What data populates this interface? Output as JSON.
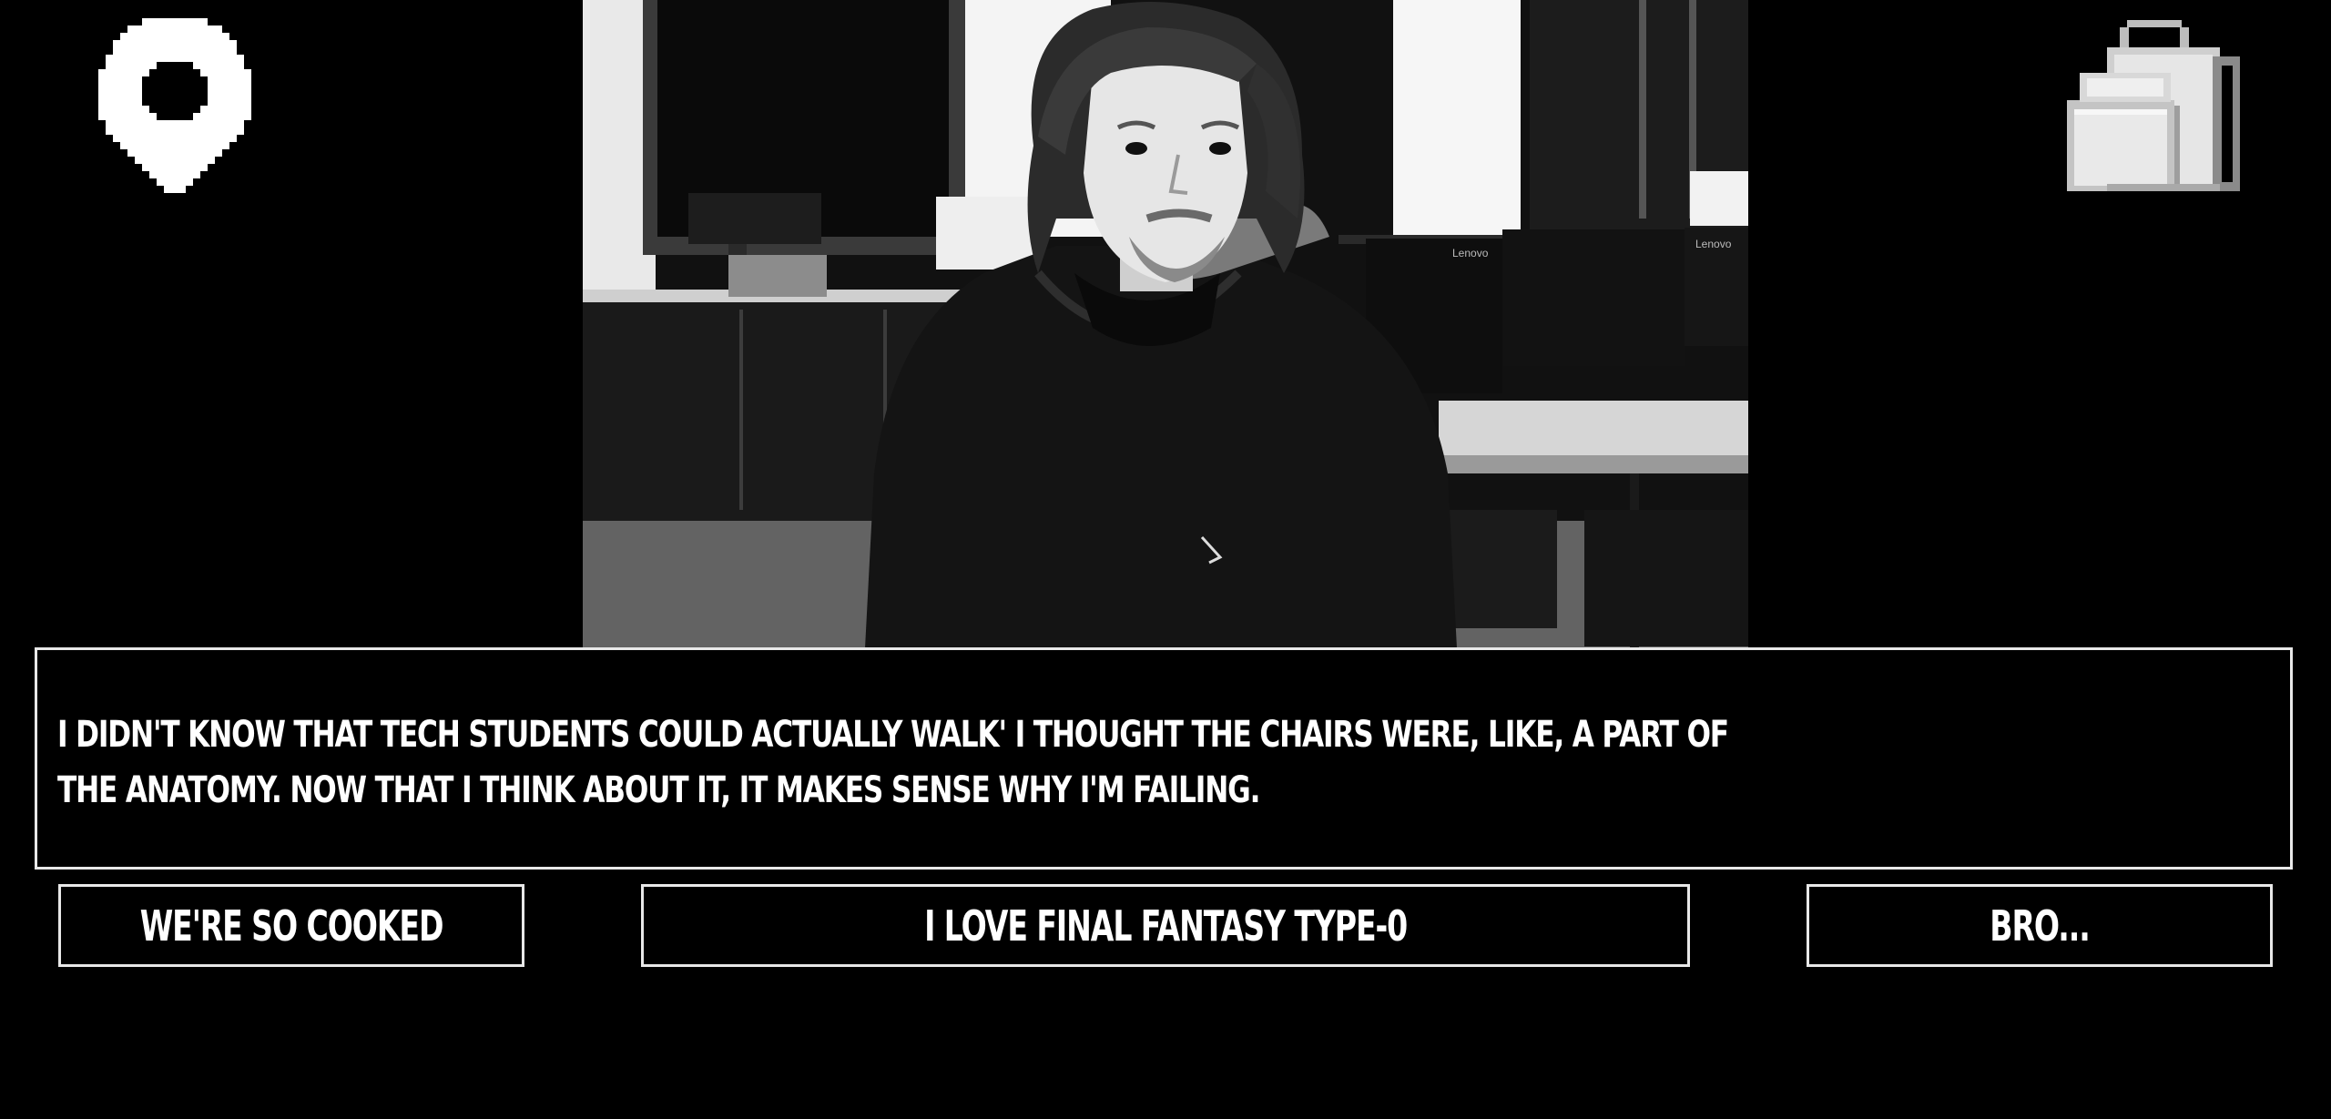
{
  "dialogue": {
    "text": "I DIDN'T KNOW THAT TECH STUDENTS COULD ACTUALLY WALK' I THOUGHT THE CHAIRS WERE, LIKE, A PART OF THE ANATOMY. NOW THAT I THINK ABOUT IT, IT MAKES SENSE WHY I'M FAILING."
  },
  "choices": [
    {
      "label": "WE'RE SO COOKED"
    },
    {
      "label": "I LOVE FINAL FANTASY TYPE-0"
    },
    {
      "label": "BRO..."
    }
  ],
  "scene": {
    "monitor_brand": "Lenovo"
  },
  "icons": {
    "map": "map-pin-icon",
    "inventory": "backpack-icon"
  },
  "colors": {
    "background": "#000000",
    "border": "#e8e8e8",
    "text": "#ffffff"
  }
}
